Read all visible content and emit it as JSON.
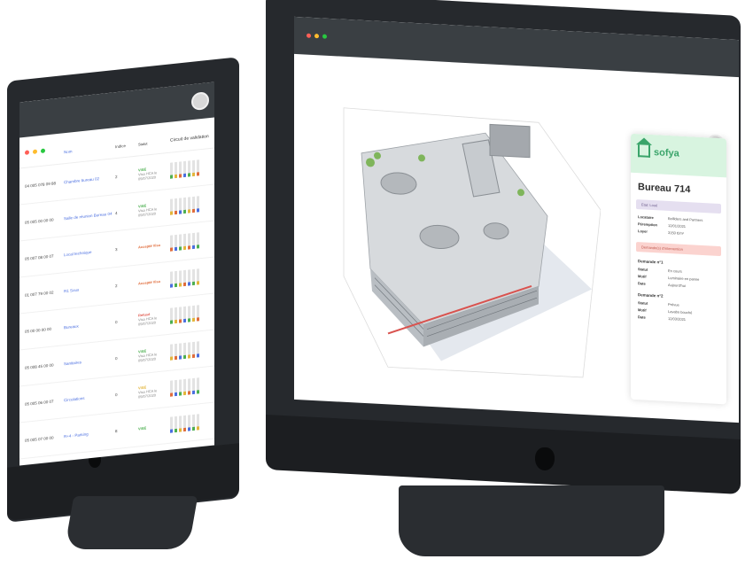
{
  "left_app": {
    "headers": [
      "Nom",
      "Indice",
      "Statut",
      "Circuit de validation"
    ],
    "rows": [
      {
        "id": "04 005 078 09 88",
        "name": "Chambre bureau 02",
        "index": "2",
        "status": "VISÉ",
        "status_sub": "Visa HCA le 05/07/2020",
        "status_color": "#4caf50"
      },
      {
        "id": "05 005 00 00 00",
        "name": "Salle de réunion Bureau 04",
        "index": "4",
        "status": "VISÉ",
        "status_sub": "Visa HCA le 05/07/2020",
        "status_color": "#4caf50"
      },
      {
        "id": "05 007 08 00 07",
        "name": "Local technique",
        "index": "3",
        "status": "Accepté Visa",
        "status_sub": "",
        "status_color": "#e06c3b"
      },
      {
        "id": "01 007 79 00 02",
        "name": "R1 Sous",
        "index": "2",
        "status": "Accepté Visa",
        "status_sub": "",
        "status_color": "#e06c3b"
      },
      {
        "id": "05 00 00 00 00",
        "name": "Bureaux",
        "index": "0",
        "status": "Refusé",
        "status_sub": "Visa HCA le 05/07/2020",
        "status_color": "#e05a4f"
      },
      {
        "id": "05 008 45 00 00",
        "name": "Sanitaires",
        "index": "0",
        "status": "VISÉ",
        "status_sub": "Visa HCA le 05/07/2020",
        "status_color": "#4caf50"
      },
      {
        "id": "05 005 06 00 07",
        "name": "Circulations",
        "index": "0",
        "status": "VISÉ",
        "status_sub": "Visa HCA le 05/07/2020",
        "status_color": "#e3b53a"
      },
      {
        "id": "05 005 07 00 00",
        "name": "R+4 - Parking",
        "index": "8",
        "status": "VISÉ",
        "status_sub": "",
        "status_color": "#4caf50"
      }
    ]
  },
  "card": {
    "brand": "sofya",
    "title": "Bureau 714",
    "status_pill": "Etat: Loué",
    "fields": [
      {
        "k": "Locataire",
        "v": "Bolliders and Partners"
      },
      {
        "k": "Péremption",
        "v": "12/01/2021"
      },
      {
        "k": "Loyer",
        "v": "3150 €/m²"
      }
    ],
    "alert_pill": "Demande(s) d'intervention",
    "requests": [
      {
        "title": "Demande n°1",
        "fields": [
          {
            "k": "Statut",
            "v": "En cours"
          },
          {
            "k": "Motif",
            "v": "Luminaire en panne"
          },
          {
            "k": "Date",
            "v": "Aujourd'hui"
          }
        ]
      },
      {
        "title": "Demande n°2",
        "fields": [
          {
            "k": "Statut",
            "v": "Prévue"
          },
          {
            "k": "Motif",
            "v": "Lavabo bouché"
          },
          {
            "k": "Date",
            "v": "12/03/2021"
          }
        ]
      }
    ]
  },
  "window_dots": [
    "#ff5f57",
    "#febc2e",
    "#28c840"
  ]
}
